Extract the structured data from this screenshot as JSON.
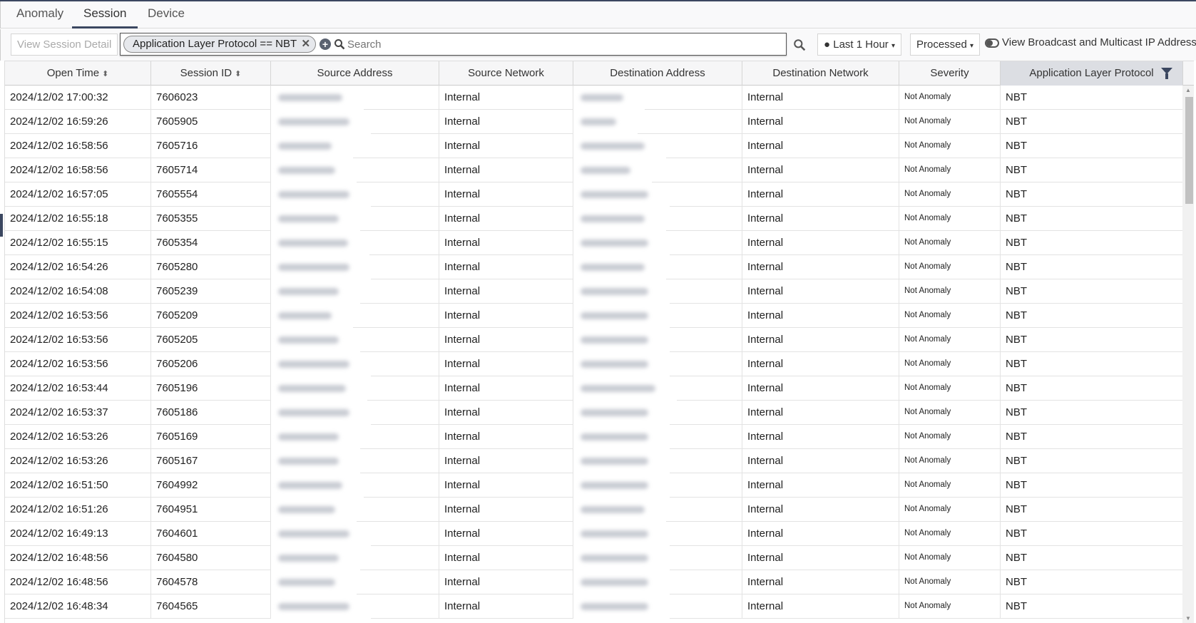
{
  "tabs": [
    {
      "label": "Anomaly"
    },
    {
      "label": "Session",
      "active": true
    },
    {
      "label": "Device"
    }
  ],
  "toolbar": {
    "view_detail": "View Session Detail",
    "filter_chip": "Application Layer Protocol == NBT",
    "search_placeholder": "Search",
    "time_range": "Last 1 Hour",
    "status": "Processed",
    "broadcast_label": "View Broadcast and Multicast IP Address"
  },
  "columns": [
    "Open Time",
    "Session ID",
    "Source Address",
    "Source Network",
    "Destination Address",
    "Destination Network",
    "Severity",
    "Application Layer Protocol"
  ],
  "rows": [
    [
      "2024/12/02 17:00:32",
      "7606023"
    ],
    [
      "2024/12/02 16:59:26",
      "7605905"
    ],
    [
      "2024/12/02 16:58:56",
      "7605716"
    ],
    [
      "2024/12/02 16:58:56",
      "7605714"
    ],
    [
      "2024/12/02 16:57:05",
      "7605554"
    ],
    [
      "2024/12/02 16:55:18",
      "7605355"
    ],
    [
      "2024/12/02 16:55:15",
      "7605354"
    ],
    [
      "2024/12/02 16:54:26",
      "7605280"
    ],
    [
      "2024/12/02 16:54:08",
      "7605239"
    ],
    [
      "2024/12/02 16:53:56",
      "7605209"
    ],
    [
      "2024/12/02 16:53:56",
      "7605205"
    ],
    [
      "2024/12/02 16:53:56",
      "7605206"
    ],
    [
      "2024/12/02 16:53:44",
      "7605196"
    ],
    [
      "2024/12/02 16:53:37",
      "7605186"
    ],
    [
      "2024/12/02 16:53:26",
      "7605169"
    ],
    [
      "2024/12/02 16:53:26",
      "7605167"
    ],
    [
      "2024/12/02 16:51:50",
      "7604992"
    ],
    [
      "2024/12/02 16:51:26",
      "7604951"
    ],
    [
      "2024/12/02 16:49:13",
      "7604601"
    ],
    [
      "2024/12/02 16:48:56",
      "7604580"
    ],
    [
      "2024/12/02 16:48:56",
      "7604578"
    ],
    [
      "2024/12/02 16:48:34",
      "7604565"
    ]
  ],
  "row_common": {
    "source_network": "Internal",
    "destination_network": "Internal",
    "severity": "Not Anomaly",
    "protocol": "NBT"
  },
  "colors": {
    "accent": "#3b4760"
  }
}
